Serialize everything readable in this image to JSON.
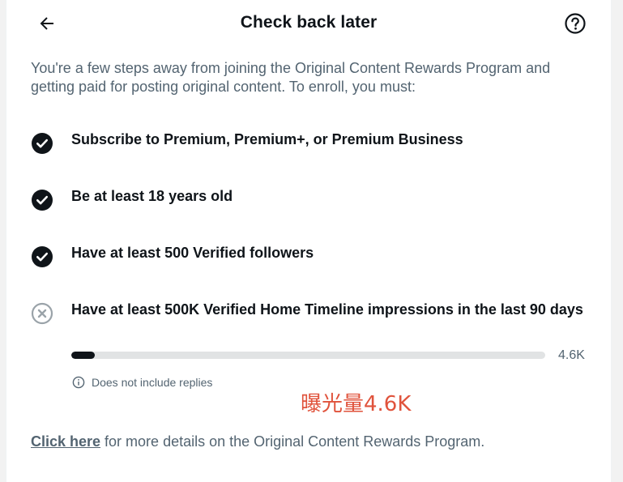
{
  "header": {
    "title": "Check back later",
    "back_icon": "arrow-left-icon",
    "help_icon": "question-circle-icon"
  },
  "intro": "You're a few steps away from joining the Original Content Rewards Program and getting paid for posting original content. To enroll, you must:",
  "requirements": [
    {
      "label": "Subscribe to Premium, Premium+, or Premium Business",
      "status": "met",
      "icon": "check-circle-icon"
    },
    {
      "label": "Be at least 18 years old",
      "status": "met",
      "icon": "check-circle-icon"
    },
    {
      "label": "Have at least 500 Verified followers",
      "status": "met",
      "icon": "check-circle-icon"
    },
    {
      "label": "Have at least 500K Verified Home Timeline impressions in the last 90 days",
      "status": "not-met",
      "icon": "x-circle-icon"
    }
  ],
  "progress": {
    "value_label": "4.6K",
    "fraction": 0.0092,
    "note": "Does not include replies",
    "note_icon": "info-icon"
  },
  "annotation": "曝光量4.6K",
  "footer": {
    "link": "Click here",
    "text": " for more details on the Original Content Rewards Program."
  },
  "colors": {
    "text_primary": "#0f1419",
    "text_secondary": "#536471",
    "track": "#e1e3e4",
    "annotation": "#e0533c"
  }
}
